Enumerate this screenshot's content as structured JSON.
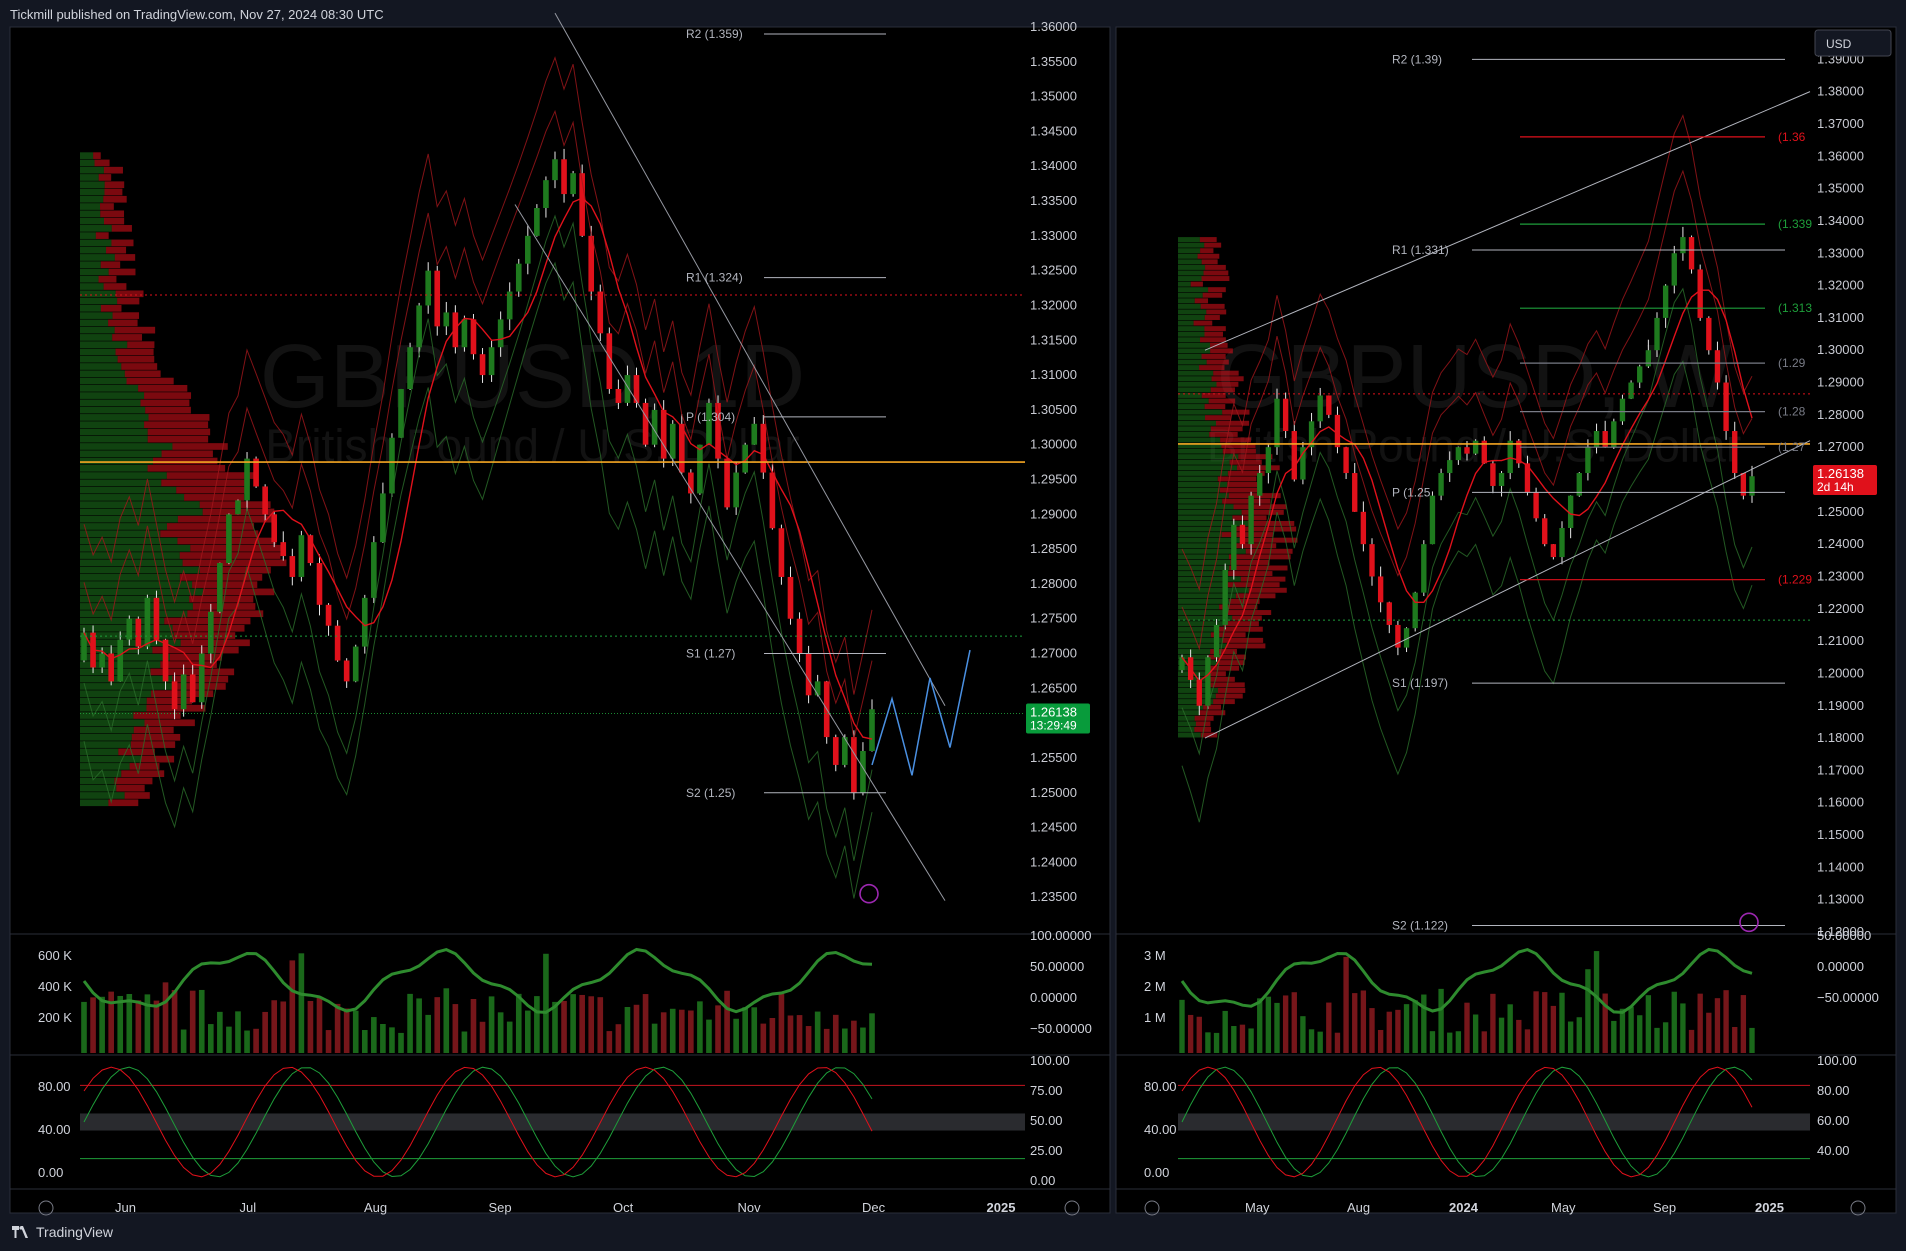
{
  "header": {
    "published": "Tickmill published on TradingView.com, Nov 27, 2024 08:30 UTC"
  },
  "footer": {
    "brand": "TradingView"
  },
  "toolbar": {
    "currency": "USD"
  },
  "colors": {
    "bg": "#000000",
    "panel_border": "#2a2e39",
    "up": "#1e7a1e",
    "down": "#e0111b",
    "poc": "#f5a623",
    "accent_green": "#089981",
    "text": "#d1d4dc"
  },
  "chart_data": [
    {
      "type": "candlestick",
      "id": "daily",
      "watermark": {
        "symbol": "GBPUSD, 1D",
        "name": "British Pound / U.S. Dollar"
      },
      "x_ticks": [
        "Jun",
        "Jul",
        "Aug",
        "Sep",
        "Oct",
        "Nov",
        "Dec",
        "2025"
      ],
      "ylim": [
        1.23,
        1.36
      ],
      "y_ticks": [
        "1.36000",
        "1.35500",
        "1.35000",
        "1.34500",
        "1.34000",
        "1.33500",
        "1.33000",
        "1.32500",
        "1.32000",
        "1.31500",
        "1.31000",
        "1.30500",
        "1.30000",
        "1.29500",
        "1.29000",
        "1.28500",
        "1.28000",
        "1.27500",
        "1.27000",
        "1.26500",
        "1.26000",
        "1.25500",
        "1.25000",
        "1.24500",
        "1.24000",
        "1.23500"
      ],
      "price_label": {
        "price": "1.26138",
        "countdown": "13:29:49"
      },
      "pivots": [
        {
          "label": "R2 (1.359)",
          "value": 1.359
        },
        {
          "label": "R1 (1.324)",
          "value": 1.324
        },
        {
          "label": "P (1.304)",
          "value": 1.304
        },
        {
          "label": "S1 (1.27)",
          "value": 1.27
        },
        {
          "label": "S2 (1.25)",
          "value": 1.25
        }
      ],
      "close_path": [
        1.273,
        1.268,
        1.27,
        1.266,
        1.272,
        1.275,
        1.271,
        1.278,
        1.272,
        1.266,
        1.262,
        1.267,
        1.263,
        1.27,
        1.276,
        1.283,
        1.29,
        1.292,
        1.298,
        1.294,
        1.29,
        1.286,
        1.284,
        1.281,
        1.287,
        1.283,
        1.277,
        1.274,
        1.269,
        1.266,
        1.271,
        1.278,
        1.286,
        1.293,
        1.301,
        1.308,
        1.314,
        1.32,
        1.325,
        1.317,
        1.319,
        1.314,
        1.318,
        1.313,
        1.31,
        1.314,
        1.318,
        1.322,
        1.326,
        1.33,
        1.334,
        1.338,
        1.341,
        1.336,
        1.339,
        1.33,
        1.322,
        1.316,
        1.308,
        1.306,
        1.31,
        1.306,
        1.3,
        1.305,
        1.298,
        1.303,
        1.296,
        1.293,
        1.3,
        1.306,
        1.298,
        1.291,
        1.296,
        1.3,
        1.303,
        1.296,
        1.288,
        1.281,
        1.275,
        1.27,
        1.264,
        1.266,
        1.258,
        1.254,
        1.258,
        1.25,
        1.256,
        1.262
      ],
      "volume_scale": {
        "labels": [
          "600 K",
          "400 K",
          "200 K"
        ],
        "right": [
          "100.00000",
          "50.00000",
          "0.00000",
          "−50.00000"
        ]
      },
      "stoch_scale": {
        "left": [
          "80.00",
          "40.00",
          "0.00"
        ],
        "right": [
          "100.00",
          "75.00",
          "50.00",
          "25.00",
          "0.00"
        ]
      }
    },
    {
      "type": "candlestick",
      "id": "weekly",
      "watermark": {
        "symbol": "GBPUSD, W",
        "name": "British Pound / U.S. Dollar"
      },
      "x_ticks": [
        "May",
        "Aug",
        "2024",
        "May",
        "Sep",
        "2025"
      ],
      "ylim": [
        1.12,
        1.4
      ],
      "y_ticks": [
        "1.39000",
        "1.38000",
        "1.37000",
        "1.36000",
        "1.35000",
        "1.34000",
        "1.33000",
        "1.32000",
        "1.31000",
        "1.30000",
        "1.29000",
        "1.28000",
        "1.27000",
        "1.26000",
        "1.25000",
        "1.24000",
        "1.23000",
        "1.22000",
        "1.21000",
        "1.20000",
        "1.19000",
        "1.18000",
        "1.17000",
        "1.16000",
        "1.15000",
        "1.14000",
        "1.13000",
        "1.12000"
      ],
      "price_label": {
        "price": "1.26138",
        "countdown": "2d 14h"
      },
      "pivots": [
        {
          "label": "R2 (1.39)",
          "value": 1.39
        },
        {
          "label": "R1 (1.331)",
          "value": 1.331
        },
        {
          "label": "P (1.25",
          "value": 1.256
        },
        {
          "label": "S1 (1.197)",
          "value": 1.197
        },
        {
          "label": "S2 (1.122)",
          "value": 1.122
        }
      ],
      "level_tags": [
        {
          "label": "(1.36",
          "value": 1.366,
          "color": "#e0111b"
        },
        {
          "label": "(1.339",
          "value": 1.339,
          "color": "#1e9e3a"
        },
        {
          "label": "(1.313",
          "value": 1.313,
          "color": "#1e9e3a"
        },
        {
          "label": "(1.29",
          "value": 1.296,
          "color": "#787b86"
        },
        {
          "label": "(1.28",
          "value": 1.281,
          "color": "#787b86"
        },
        {
          "label": "(1.27",
          "value": 1.27,
          "color": "#787b86"
        },
        {
          "label": "(1.229",
          "value": 1.229,
          "color": "#e0111b"
        }
      ],
      "close_path": [
        1.205,
        1.198,
        1.19,
        1.205,
        1.215,
        1.232,
        1.246,
        1.24,
        1.255,
        1.262,
        1.27,
        1.285,
        1.275,
        1.26,
        1.27,
        1.278,
        1.286,
        1.28,
        1.27,
        1.262,
        1.25,
        1.24,
        1.23,
        1.222,
        1.215,
        1.208,
        1.214,
        1.225,
        1.24,
        1.255,
        1.262,
        1.266,
        1.27,
        1.268,
        1.272,
        1.265,
        1.258,
        1.262,
        1.272,
        1.265,
        1.256,
        1.248,
        1.24,
        1.236,
        1.245,
        1.255,
        1.262,
        1.27,
        1.275,
        1.27,
        1.278,
        1.285,
        1.29,
        1.295,
        1.3,
        1.31,
        1.32,
        1.33,
        1.335,
        1.325,
        1.31,
        1.3,
        1.29,
        1.275,
        1.262,
        1.255,
        1.261
      ],
      "volume_scale": {
        "labels": [
          "3 M",
          "2 M",
          "1 M"
        ],
        "right": [
          "50.00000",
          "0.00000",
          "−50.00000"
        ]
      },
      "stoch_scale": {
        "left": [
          "80.00",
          "40.00",
          "0.00"
        ],
        "right": [
          "100.00",
          "80.00",
          "60.00",
          "40.00"
        ]
      }
    }
  ]
}
